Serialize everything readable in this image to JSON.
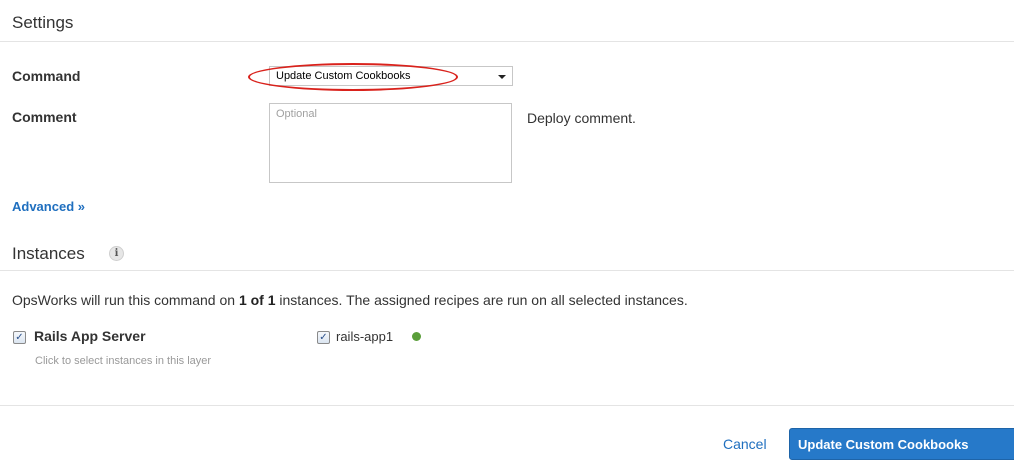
{
  "settings": {
    "title": "Settings",
    "command_label": "Command",
    "command_value": "Update Custom Cookbooks",
    "comment_label": "Comment",
    "comment_placeholder": "Optional",
    "comment_hint": "Deploy comment.",
    "advanced_link": "Advanced »"
  },
  "instances": {
    "title": "Instances",
    "info_icon": "i",
    "description_prefix": "OpsWorks will run this command on ",
    "description_count": "1 of 1",
    "description_suffix": " instances. The assigned recipes are run on all selected instances.",
    "layer": {
      "name": "Rails App Server",
      "checked": true,
      "hint": "Click to select instances in this layer"
    },
    "instance": {
      "name": "rails-app1",
      "checked": true,
      "status_color": "#5a9e3a"
    }
  },
  "footer": {
    "cancel_label": "Cancel",
    "submit_label": "Update Custom Cookbooks"
  },
  "colors": {
    "accent": "#2679c9",
    "link": "#1f6fbf",
    "highlight": "#d9221c"
  }
}
